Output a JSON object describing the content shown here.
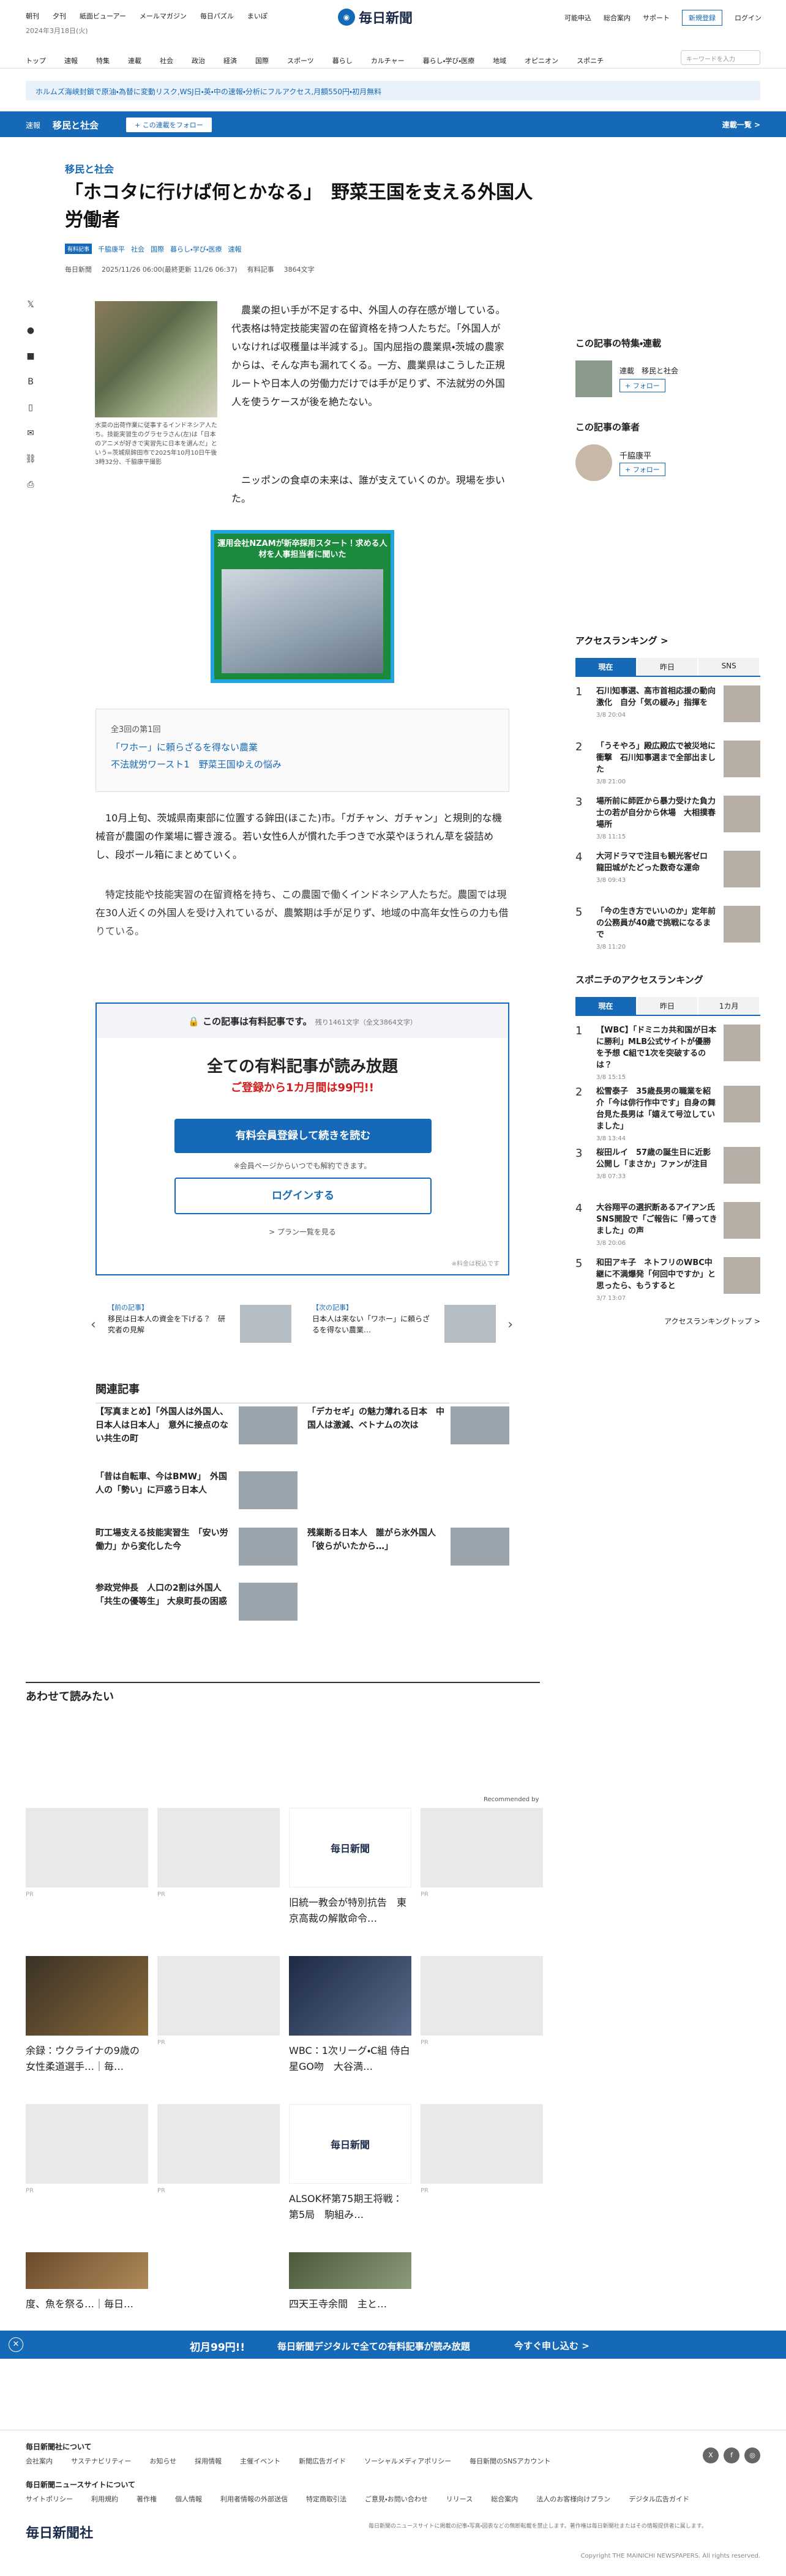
{
  "header": {
    "top_links": [
      "朝刊",
      "夕刊",
      "紙面ビューアー",
      "メールマガジン",
      "毎日パズル",
      "まいぽ"
    ],
    "date": "2024年3月18日(火)",
    "logo": "毎日新聞",
    "right_links": [
      "可能申込",
      "総合案内",
      "サポート"
    ],
    "register": "新規登録",
    "login": "ログイン",
    "nav": [
      "トップ",
      "速報",
      "特集",
      "連載",
      "社会",
      "政治",
      "経済",
      "国際",
      "スポーツ",
      "暮らし",
      "カルチャー",
      "暮らし・学び・医療",
      "地域",
      "オピニオン",
      "スポニチ"
    ],
    "search_placeholder": "キーワードを入力"
  },
  "banner": "ホルムズ海峡封鎖で原油・為替に変動リスク,WSJ日・英・中の速報・分析にフルアクセス,月額550円・初月無料",
  "category": {
    "kind": "速報",
    "name": "移民と社会",
    "follow": "+ この連載をフォロー",
    "list": "連載一覧 >"
  },
  "article": {
    "section": "移民と社会",
    "title": "「ホコタに行けば何とかなる」　野菜王国を支える外国人労働者",
    "tags": [
      "有料記事",
      "千脇康平",
      "社会",
      "国際",
      "暮らし・学び・医療",
      "速報"
    ],
    "meta": [
      "毎日新聞",
      "2025/11/26 06:00(最終更新 11/26 06:37)",
      "有料記事",
      "3864文字"
    ],
    "caption": "水菜の出荷作業に従事するインドネシア人たち。技能実習生のグラセラさん(左)は「日本のアニメが好きで実習先に日本を選んだ」という=茨城県鉾田市で2025年10月10日午後3時32分、千脇康平撮影",
    "lead": "農業の担い手が不足する中、外国人の存在感が増している。代表格は特定技能実習の在留資格を持つ人たちだ。「外国人がいなければ収穫量は半減する」。国内屈指の農業県・茨城の農家からは、そんな声も漏れてくる。一方、農業県はこうした正規ルートや日本人の労働力だけでは手が足りず、不法就労の外国人を使うケースが後を絶たない。",
    "lead2": "ニッポンの食卓の未来は、誰が支えていくのか。現場を歩いた。",
    "ad": "運用会社NZAMが新卒採用スタート！求める人材を人事担当者に聞いた",
    "series": {
      "head": "全3回の第1回",
      "items": [
        "「ワホー」に頼らざるを得ない農業",
        "不法就労ワースト1　野菜王国ゆえの悩み"
      ]
    },
    "p1": "10月上旬、茨城県南東部に位置する鉾田(ほこた)市。「ガチャン、ガチャン」と規則的な機械音が農園の作業場に響き渡る。若い女性6人が慣れた手つきで水菜やほうれん草を袋詰めし、段ボール箱にまとめていく。",
    "p2": "特定技能や技能実習の在留資格を持ち、この農園で働くインドネシア人たちだ。農園では現在30人近くの外国人を受け入れているが、農繁期は手が足りず、地域の中高年女性らの力も借りている。"
  },
  "paywall": {
    "head": "この記事は有料記事です。",
    "remain": "残り1461文字（全文3864文字）",
    "big": "全ての有料記事が読み放題",
    "sub": "ご登録から1カ月間は99円!!",
    "reg_btn": "有料会員登録して続きを読む",
    "note": "※会員ページからいつでも解約できます。",
    "login_btn": "ログインする",
    "plans": "> プラン一覧を見る",
    "small": "※料金は税込です"
  },
  "prevnext": [
    {
      "label": "【前の記事】",
      "text": "移民は日本人の資金を下げる？　研究者の見解"
    },
    {
      "label": "【次の記事】",
      "text": "日本人は来ない「ワホー」に頼らざるを得ない農業…"
    }
  ],
  "related": {
    "heading": "関連記事",
    "items": [
      "【写真まとめ】「外国人は外国人、日本人は日本人」　意外に接点のない共生の町",
      "「デカセギ」の魅力薄れる日本　中国人は激減、ベトナムの次は",
      "「昔は自転車、今はBMW」　外国人の「勢い」に戸惑う日本人",
      "町工場支える技能実習生　「安い労働力」から変化した今",
      "残業断る日本人　誰がら氷外国人「彼らがいたから…」",
      "参政党伸長　人口の2割は外国人「共生の優等生」 大泉町長の困惑"
    ]
  },
  "recommend": {
    "heading": "あわせて読みたい",
    "by": "Recommended by",
    "items": [
      "旧統一教会が特別抗告　東京高裁の解散命令…",
      "余録：ウクライナの9歳の女性柔道選手…｜毎…",
      "WBC：1次リーグ・C組 侍白星GO吻　大谷満…",
      "ALSOK杯第75期王将戦：第5局　駒組み…",
      "度、魚を祭る…｜毎日…",
      "四天王寺余間　主と…"
    ],
    "pr": "PR"
  },
  "sidebar": {
    "features_h": "この記事の特集・連載",
    "feature": "連載　移民と社会",
    "follow": "+ フォロー",
    "author_h": "この記事の筆者",
    "author": "千脇康平",
    "ranking_h": "アクセスランキング >",
    "tabs": [
      "現在",
      "昨日",
      "SNS"
    ],
    "ranks": [
      {
        "t": "石川知事選、高市首相応援の動向激化　自分「気の緩み」指揮を",
        "d": "3/8 20:04"
      },
      {
        "t": "「うそやろ」殿広殿広で被災地に衝撃　石川知事選まで全部出ました",
        "d": "3/8 21:00"
      },
      {
        "t": "場所前に師匠から暴力受けた負力士の若が自分から休場　大相撲春場所",
        "d": "3/8 11:15"
      },
      {
        "t": "大河ドラマで注目も観光客ゼロ　龍田城がたどった数奇な運命",
        "d": "3/8 09:43"
      },
      {
        "t": "「今の生き方でいいのか」定年前の公務員が40歳で挑戦になるまで",
        "d": "3/8 11:20"
      }
    ],
    "supo_h": "スポニチのアクセスランキング",
    "supo_tabs": [
      "現在",
      "昨日",
      "1カ月"
    ],
    "supo": [
      {
        "t": "【WBC】「ドミニカ共和国が日本に勝利」MLB公式サイトが優勝を予想 C組で1次を突破するのは？",
        "d": "3/8 15:15"
      },
      {
        "t": "松雪泰子　35歳長男の職業を紹介「今は俳行作中です」自身の舞台見た長男は「嬉えて号泣していました」",
        "d": "3/8 13:44"
      },
      {
        "t": "桜田ルイ　57歳の誕生日に近影公開し「まさか」ファンが注目",
        "d": "3/8 07:33"
      },
      {
        "t": "大谷翔平の選択断あるアイアン氏　SNS開設で「ご報告に「帰ってきました」の声",
        "d": "3/8 20:06"
      },
      {
        "t": "和田アキ子　ネトフリのWBC中継に不満爆発「何回中ですか」と思ったら、もうすると",
        "d": "3/7 13:07"
      }
    ],
    "more": "アクセスランキングトップ >"
  },
  "sticky": {
    "m1": "初月99円!!",
    "m2": "毎日新聞デジタルで全ての有料記事が読み放題",
    "cta": "今すぐ申し込む >"
  },
  "footer": {
    "h1": "毎日新聞社について",
    "row1": [
      "会社案内",
      "サステナビリティー",
      "お知らせ",
      "採用情報",
      "主催イベント",
      "新聞広告ガイド",
      "ソーシャルメディアポリシー",
      "毎日新聞のSNSアカウント"
    ],
    "h2": "毎日新聞ニュースサイトについて",
    "row2": [
      "サイトポリシー",
      "利用規約",
      "著作権",
      "個人情報",
      "利用者情報の外部送信",
      "特定商取引法",
      "ご意見・お問い合わせ",
      "リリース",
      "総合案内",
      "法人のお客様向けプラン",
      "デジタル広告ガイド"
    ],
    "logo": "毎日新聞社",
    "copy": "毎日新聞のニュースサイトに掲載の記事・写真・図表などの無断転載を禁止します。著作権は毎日新聞社またはその情報提供者に属します。",
    "cr": "Copyright THE MAINICHI NEWSPAPERS. All rights reserved."
  }
}
